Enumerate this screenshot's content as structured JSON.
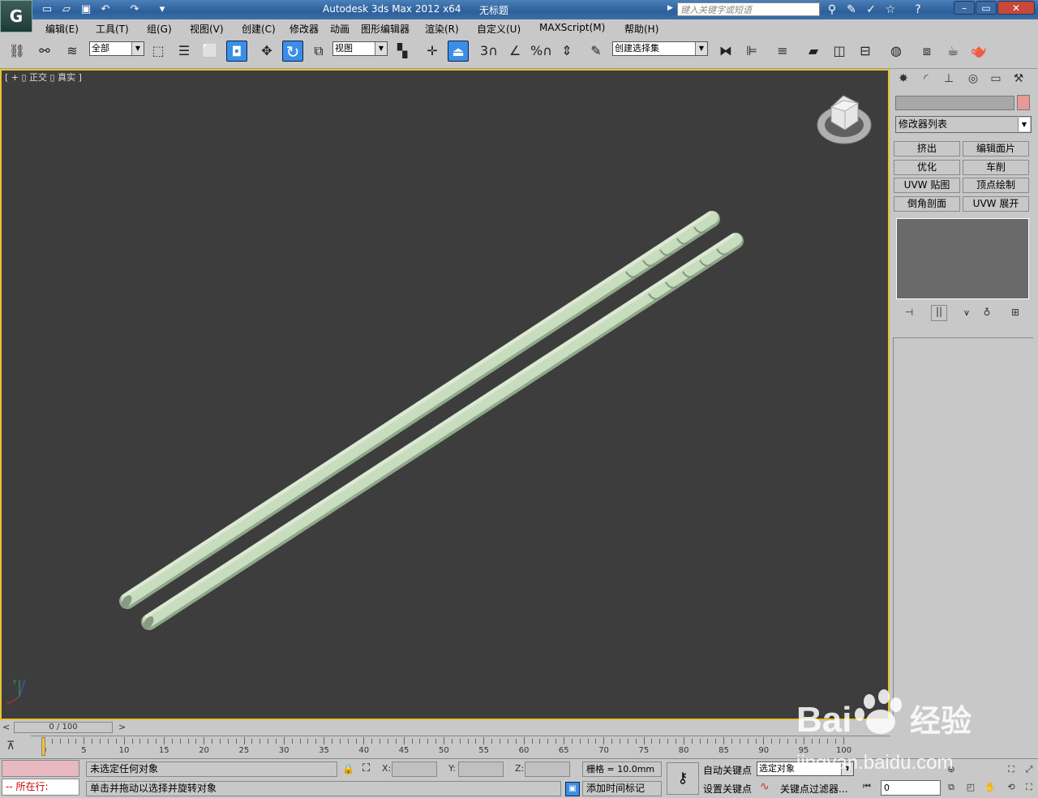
{
  "window": {
    "app_title": "Autodesk 3ds Max  2012 x64",
    "doc_title": "无标题",
    "search_placeholder": "键入关键字或短语"
  },
  "menu": {
    "items": [
      "编辑(E)",
      "工具(T)",
      "组(G)",
      "视图(V)",
      "创建(C)",
      "修改器",
      "动画",
      "图形编辑器",
      "渲染(R)",
      "自定义(U)",
      "MAXScript(M)",
      "帮助(H)"
    ]
  },
  "toolbar": {
    "selection_filter": "全部",
    "ref_coord": "视图",
    "named_selection": "创建选择集",
    "snap_label": "3",
    "percent_snap_label": "%"
  },
  "viewport": {
    "label": "[ + ▯ 正交 ▯ 真实 ]",
    "background": "#3d3d3d",
    "border_color": "#e8c130",
    "object_color": "#c8dcbe"
  },
  "command_panel": {
    "modifier_list": "修改器列表",
    "buttons": [
      "挤出",
      "编辑面片",
      "优化",
      "车削",
      "UVW 贴图",
      "顶点绘制",
      "倒角剖面",
      "UVW 展开"
    ],
    "object_color": "#e59a9a"
  },
  "timeline": {
    "slider_text": "0 / 100",
    "ticks": [
      "0",
      "5",
      "10",
      "15",
      "20",
      "25",
      "30",
      "35",
      "40",
      "45",
      "50",
      "55",
      "60",
      "65",
      "70",
      "75",
      "80",
      "85",
      "90",
      "95",
      "100"
    ]
  },
  "status": {
    "selection_status": "未选定任何对象",
    "prompt": "单击并拖动以选择并旋转对象",
    "listener_label": "所在行:",
    "x_label": "X:",
    "y_label": "Y:",
    "z_label": "Z:",
    "grid": "栅格 = 10.0mm",
    "add_time_tag": "添加时间标记",
    "auto_key": "自动关键点",
    "set_key": "设置关键点",
    "key_mode": "选定对象",
    "key_filters": "关键点过滤器...",
    "current_frame": "0"
  },
  "watermark": {
    "brand": "Bai",
    "brand_cn": "经验",
    "url": "jingyan.baidu.com"
  }
}
